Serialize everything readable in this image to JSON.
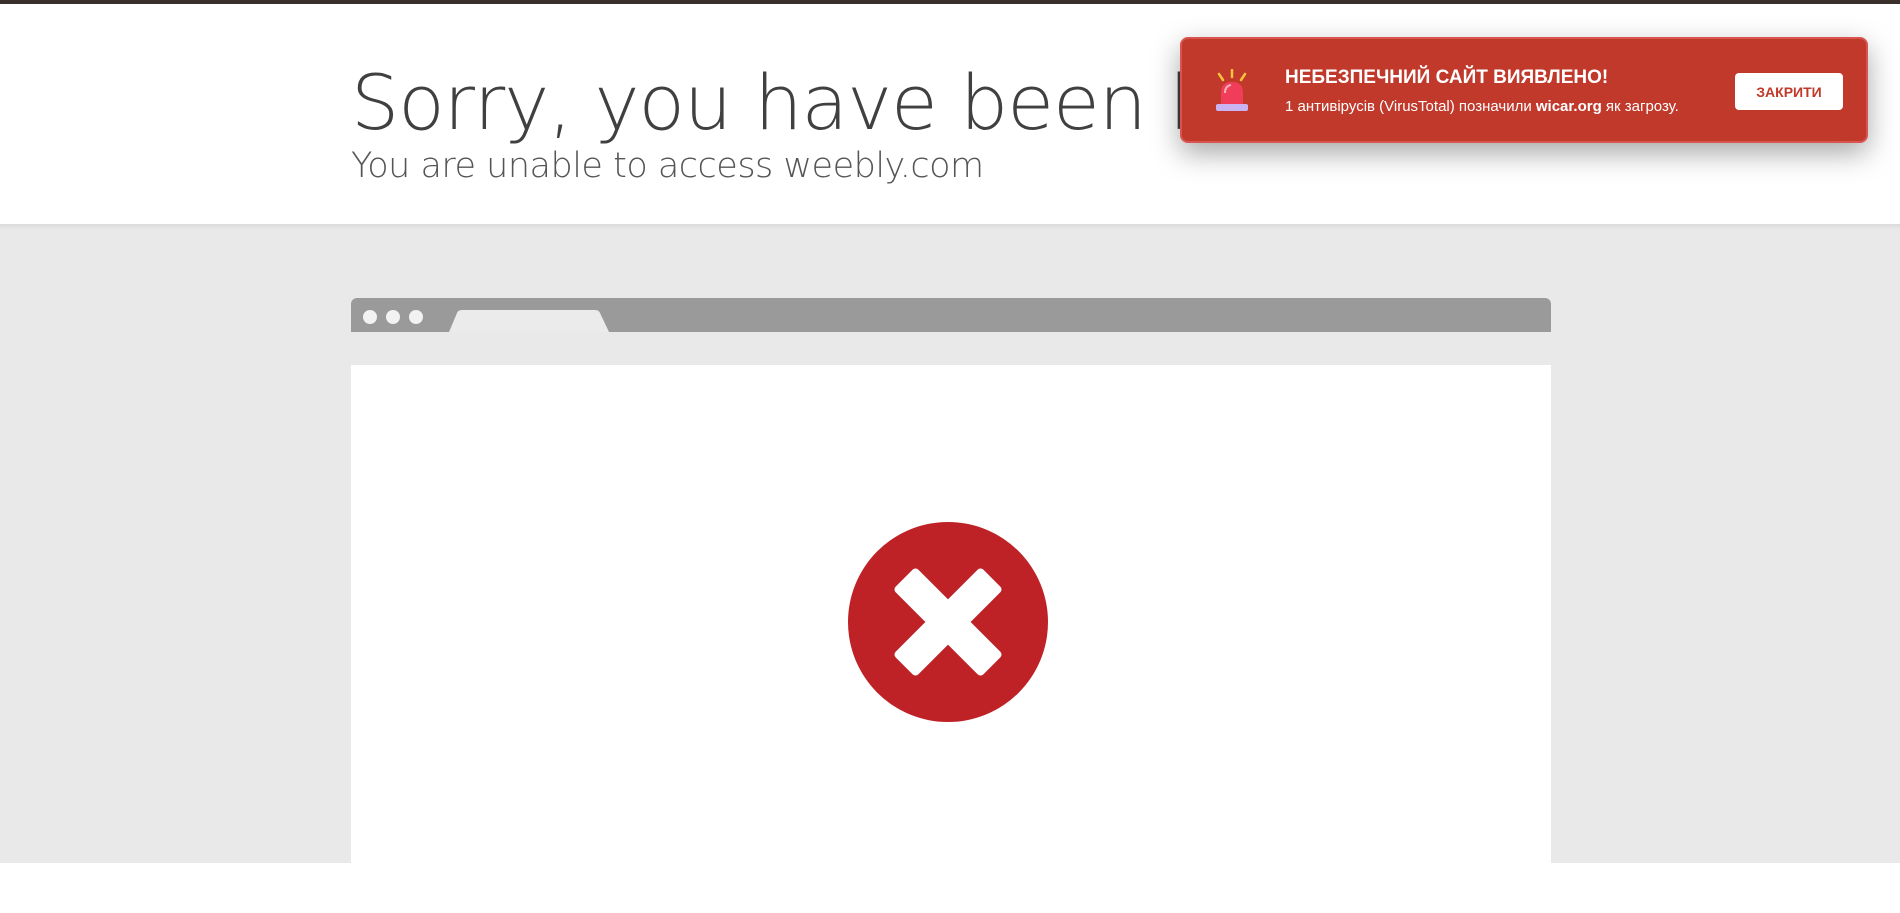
{
  "header": {
    "title": "Sorry, you have been blocked",
    "subtitle": "You are unable to access weebly.com"
  },
  "illustration": {
    "icon": "error-x-icon",
    "icon_color": "#be2227"
  },
  "toast": {
    "title": "НЕБЕЗПЕЧНИЙ САЙТ ВИЯВЛЕНО!",
    "message_prefix": "1 антивірусів (VirusTotal) позначили ",
    "domain": "wicar.org",
    "message_suffix": " як загрозу.",
    "close_label": "ЗАКРИТИ",
    "icon": "siren-icon",
    "background_color": "#c0392b"
  }
}
